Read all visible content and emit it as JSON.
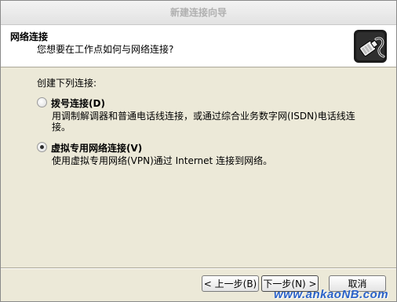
{
  "window": {
    "title": "新建连接向导"
  },
  "header": {
    "title": "网络连接",
    "subtitle": "您想要在工作点如何与网络连接?",
    "icon": "network-cable-icon"
  },
  "content": {
    "prompt": "创建下列连接:",
    "options": [
      {
        "label": "拨号连接(D)",
        "description": "用调制解调器和普通电话线连接，或通过综合业务数字网(ISDN)电话线连接。",
        "selected": false
      },
      {
        "label": "虚拟专用网络连接(V)",
        "description": "使用虚拟专用网络(VPN)通过 Internet 连接到网络。",
        "selected": true
      }
    ]
  },
  "buttons": {
    "back": "< 上一步(B)",
    "next": "下一步(N) >",
    "cancel": "取消"
  },
  "watermark": "www.ankaoNB.com"
}
